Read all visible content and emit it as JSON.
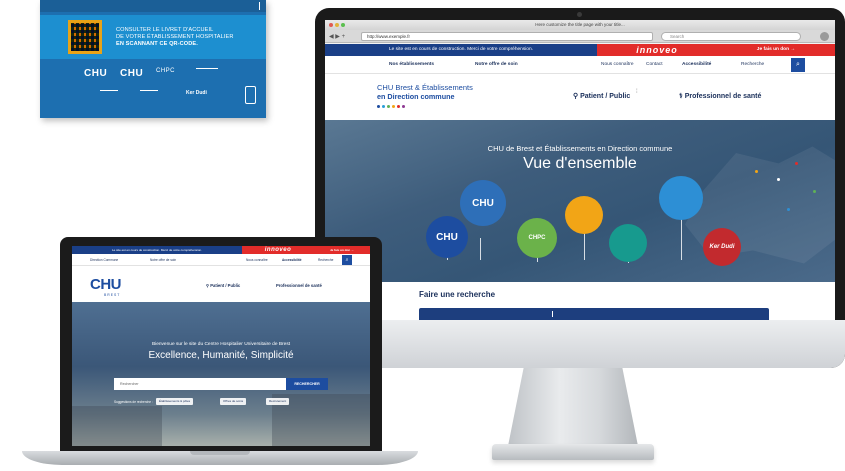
{
  "booklet": {
    "qr_line1": "CONSULTER LE LIVRET D'ACCUEIL",
    "qr_line2": "DE VOTRE ÉTABLISSEMENT HOSPITALIER",
    "qr_line3": "EN SCANNANT CE QR-CODE.",
    "logo_chu1": "CHU",
    "logo_chu2": "CHU",
    "logo_chpc": "CHPC",
    "logo_ker": "Ker Dudi"
  },
  "desktop": {
    "window_title": "Here customize the title page with your title...",
    "url": "http://www.exemple.fr",
    "search_placeholder": "Search",
    "banner": {
      "notice": "Le site est en cours de construction. Merci de votre compréhension.",
      "brand": "innoveo",
      "donate": "Je fais un don →"
    },
    "nav": {
      "etablissements": "Nos établissements",
      "offre": "Notre offre de soin",
      "connaitre": "Nous connaître",
      "contact": "Contact",
      "accessibilite": "Accessibilité",
      "recherche": "Recherche"
    },
    "header": {
      "title_line1": "CHU Brest & Établissements",
      "title_line2": "en Direction commune",
      "patient": "Patient / Public",
      "pro": "Professionnel de santé"
    },
    "hero": {
      "kicker": "CHU de Brest et Établissements en Direction commune",
      "title": "Vue d'ensemble",
      "bubbles": [
        "CHU",
        "CHU",
        "CHPC",
        "",
        "",
        "",
        "Ker Dudi"
      ]
    },
    "search": {
      "label": "Faire une recherche"
    },
    "colors": {
      "navy": "#1a3f87",
      "red": "#e22c2a",
      "blue": "#1d4da0"
    }
  },
  "laptop": {
    "banner": {
      "notice": "Le site est en cours de construction. Merci de votre compréhension.",
      "brand": "innoveo",
      "donate": "Je fais un don →"
    },
    "nav": {
      "direction": "Direction Commune",
      "offre": "Notre offre de soin",
      "connaitre": "Nous connaître",
      "accessibilite": "Accessibilité",
      "recherche": "Recherche"
    },
    "header": {
      "logo": "CHU",
      "logo_sub": "BREST",
      "patient": "Patient / Public",
      "pro": "Professionnel de santé"
    },
    "hero": {
      "kicker": "Bienvenue sur le site du Centre Hospitalier Universitaire de Brest",
      "title": "Excellence, Humanité, Simplicité",
      "search_placeholder": "Rechercher",
      "search_button": "RECHERCHER",
      "suggest_label": "Suggestions de recherche :",
      "chips": [
        "Établissements & pôles",
        "Offres de soins",
        "Recrutement"
      ]
    }
  }
}
